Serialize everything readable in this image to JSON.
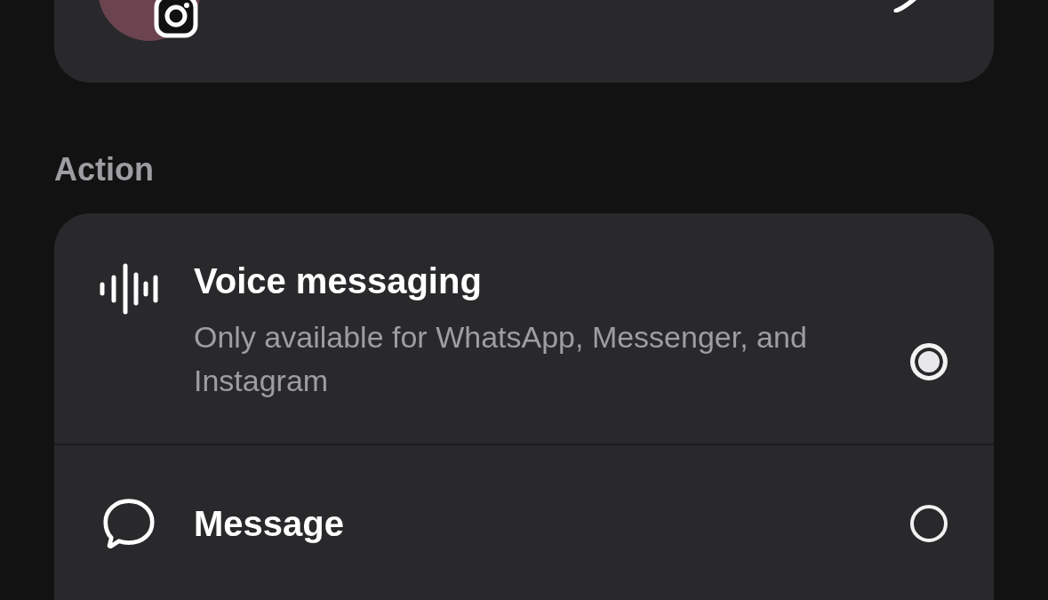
{
  "profile_card": {
    "badge_shown": true
  },
  "section_label": "Action",
  "options": [
    {
      "kind": "voice",
      "title": "Voice messaging",
      "subtitle": "Only available for WhatsApp, Messenger, and Instagram",
      "selected": true
    },
    {
      "kind": "message",
      "title": "Message",
      "selected": false
    }
  ]
}
